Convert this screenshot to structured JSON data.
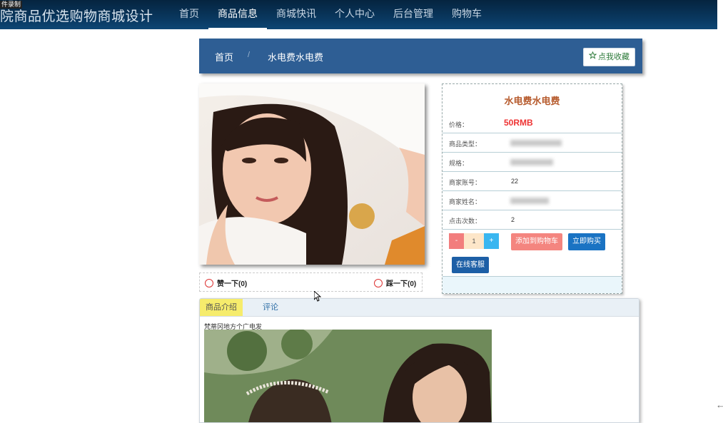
{
  "recording_label": "件录制",
  "header": {
    "site_title": "院商品优选购物商城设计"
  },
  "nav": [
    {
      "label": "首页",
      "active": false
    },
    {
      "label": "商品信息",
      "active": true
    },
    {
      "label": "商城快讯",
      "active": false
    },
    {
      "label": "个人中心",
      "active": false
    },
    {
      "label": "后台管理",
      "active": false
    },
    {
      "label": "购物车",
      "active": false
    }
  ],
  "breadcrumb": {
    "home": "首页",
    "separator": "/",
    "current": "水电费水电费"
  },
  "favorite_button": {
    "icon": "star-outline-icon",
    "label": "点我收藏"
  },
  "feedback": {
    "like": "赞一下(0)",
    "dislike": "踩一下(0)"
  },
  "product": {
    "name": "水电费水电费",
    "price_label": "价格：",
    "price_value": "50RMB",
    "fields": [
      {
        "label": "商品类型：",
        "value": ""
      },
      {
        "label": "规格：",
        "value": ""
      },
      {
        "label": "商家账号：",
        "value": "22"
      },
      {
        "label": "商家姓名：",
        "value": ""
      },
      {
        "label": "点击次数：",
        "value": "2"
      }
    ],
    "quantity": {
      "minus": "-",
      "value": "1",
      "plus": "+"
    },
    "add_to_cart": "添加到购物车",
    "buy_now": "立即购买",
    "customer_service": "在线客服"
  },
  "tabs": [
    {
      "label": "商品介绍",
      "active": true
    },
    {
      "label": "评论",
      "active": false
    }
  ],
  "description": {
    "text": "梵蒂冈地方个广电发"
  },
  "colors": {
    "nav_bg": "#0a3a63",
    "breadcrumb_bg": "#2e5e94",
    "price": "#ee3333",
    "product_title": "#b65a2c",
    "cart_button": "#f4857f",
    "buy_button": "#1a73c3",
    "active_tab": "#f6ec6c"
  }
}
